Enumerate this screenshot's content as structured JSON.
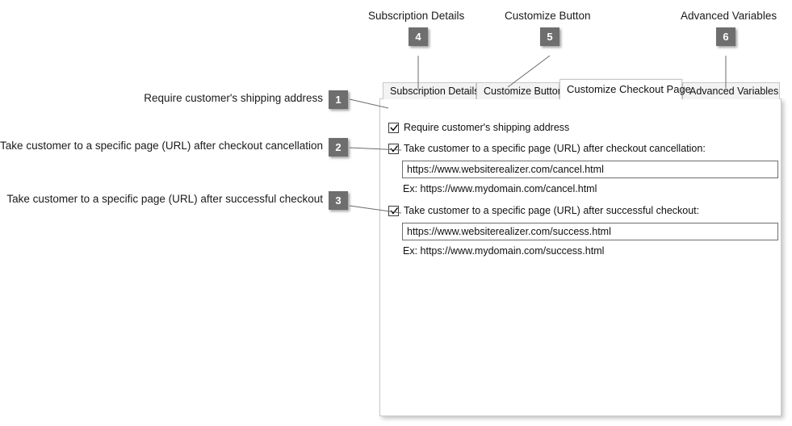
{
  "panel": {
    "tabs": [
      {
        "label": "Subscription Details",
        "active": false
      },
      {
        "label": "Customize Button",
        "active": false
      },
      {
        "label": "Customize Checkout Page",
        "active": true
      },
      {
        "label": "Advanced Variables",
        "active": false
      }
    ],
    "options": [
      {
        "label": "Require customer's shipping address",
        "checked": true,
        "has_input": false
      },
      {
        "label": "Take customer to a specific page (URL) after checkout cancellation:",
        "checked": true,
        "has_input": true,
        "input_value": "https://www.websiterealizer.com/cancel.html",
        "hint": "Ex: https://www.mydomain.com/cancel.html"
      },
      {
        "label": "Take customer to a specific page (URL) after successful checkout:",
        "checked": true,
        "has_input": true,
        "input_value": "https://www.websiterealizer.com/success.html",
        "hint": "Ex: https://www.mydomain.com/success.html"
      }
    ]
  },
  "annotations": [
    {
      "number": "1",
      "text": "Require customer's shipping address"
    },
    {
      "number": "2",
      "text": "Take customer to a specific page (URL) after checkout cancellation"
    },
    {
      "number": "3",
      "text": "Take customer to a specific page (URL) after successful checkout"
    },
    {
      "number": "4",
      "text": "Subscription Details"
    },
    {
      "number": "5",
      "text": "Customize Button"
    },
    {
      "number": "6",
      "text": "Advanced Variables"
    }
  ],
  "colors": {
    "badge_background": "#6e6e6e",
    "badge_text": "#ffffff",
    "leader_line": "#6b6b6b",
    "panel_border": "#c8c8c8",
    "tab_inactive_background": "#f3f3f3",
    "tab_active_background": "#ffffff",
    "input_border": "#6f6f6f",
    "text": "#111111"
  }
}
